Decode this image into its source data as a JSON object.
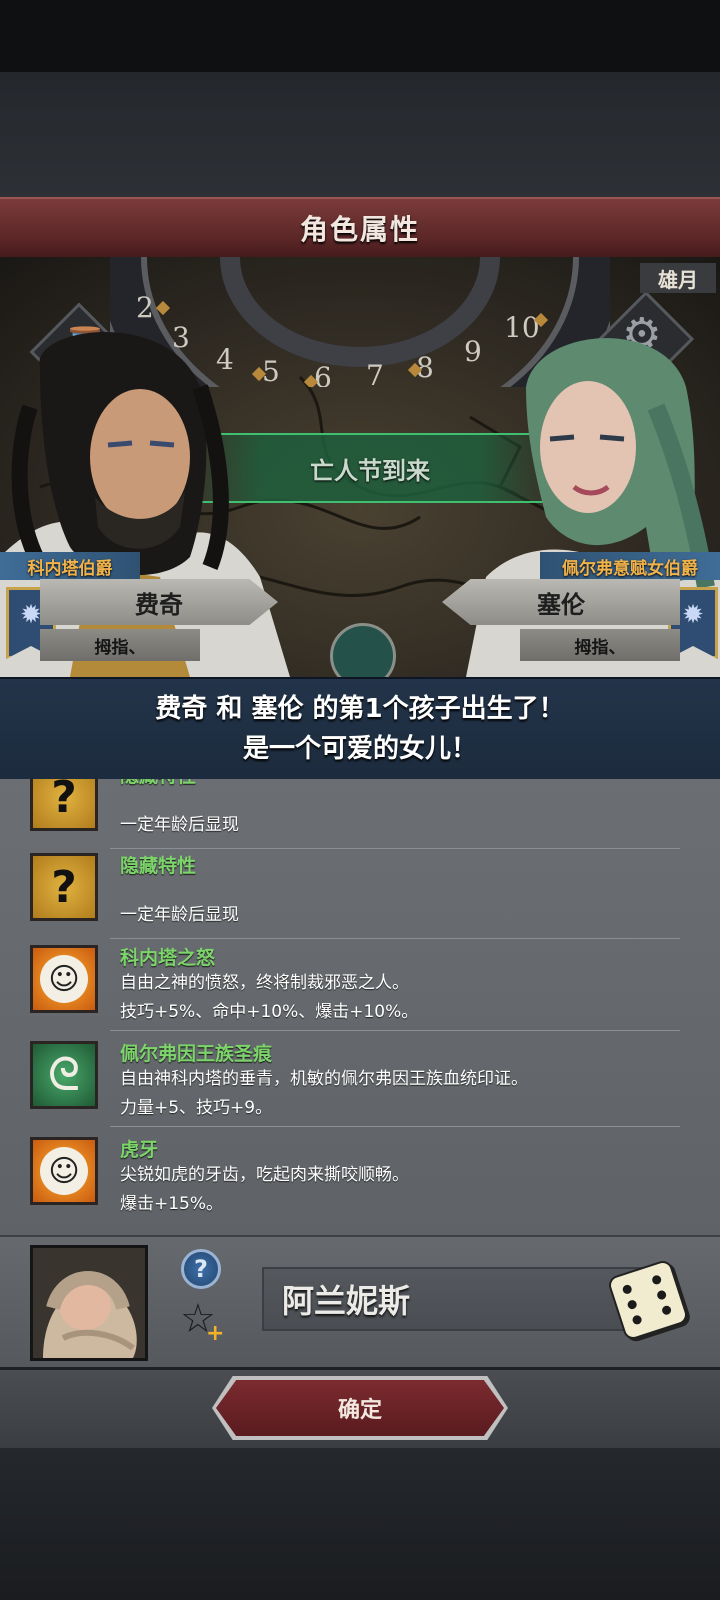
{
  "screen_title": "角色属性",
  "scene": {
    "calendar_numbers": [
      "2",
      "3",
      "4",
      "5",
      "6",
      "7",
      "8",
      "9",
      "10"
    ],
    "month_label": "雄月",
    "event_banner": "亡人节到来"
  },
  "father": {
    "title": "科内塔伯爵",
    "name": "费奇",
    "subtitle": "拇指、"
  },
  "mother": {
    "title": "佩尔弗意赋女伯爵",
    "name": "塞伦",
    "subtitle": "拇指、"
  },
  "announcement": {
    "line1": "费奇 和 塞伦 的第1个孩子出生了！",
    "line2": "是一个可爱的女儿！"
  },
  "traits": [
    {
      "icon": "question-icon",
      "name": "隐藏特性",
      "desc": [
        "一定年龄后显现"
      ]
    },
    {
      "icon": "question-icon",
      "name": "隐藏特性",
      "desc": [
        "一定年龄后显现"
      ]
    },
    {
      "icon": "smile-icon",
      "name": "科内塔之怒",
      "desc": [
        "自由之神的愤怒，终将制裁邪恶之人。",
        "技巧+5%、命中+10%、爆击+10%。"
      ]
    },
    {
      "icon": "swirl-icon",
      "name": "佩尔弗因王族圣痕",
      "desc": [
        "自由神科内塔的垂青，机敏的佩尔弗因王族血统印证。",
        "力量+5、技巧+9。"
      ]
    },
    {
      "icon": "smile-icon",
      "name": "虎牙",
      "desc": [
        "尖锐如虎的牙齿，吃起肉来撕咬顺畅。",
        "爆击+15%。"
      ]
    }
  ],
  "child": {
    "name": "阿兰妮斯",
    "info_badge": "?",
    "favorite_plus": "+"
  },
  "confirm_label": "确定",
  "colors": {
    "title_bar": "#5b2627",
    "announce_bg": "#1c2b3d",
    "trait_name": "#7cd46a",
    "title_tag_text": "#f2b44a",
    "confirm_button": "#6b2428"
  }
}
